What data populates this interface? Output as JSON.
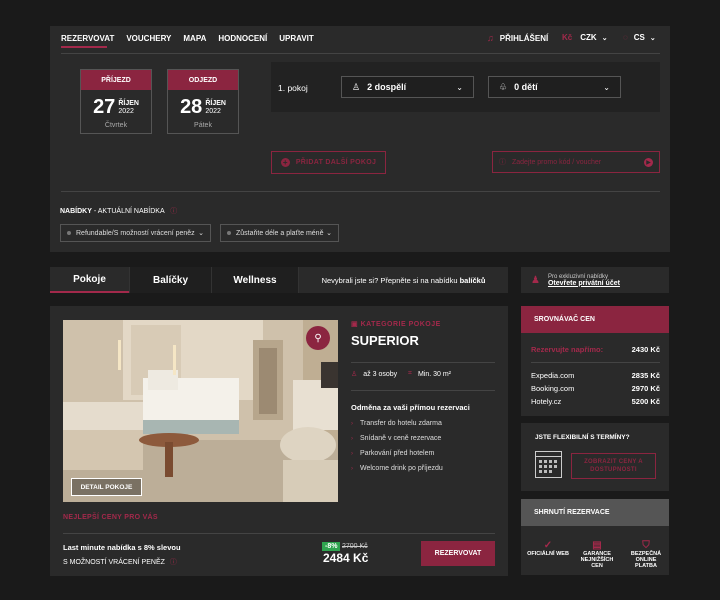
{
  "nav": {
    "items": [
      "REZERVOVAT",
      "VOUCHERY",
      "MAPA",
      "HODNOCENÍ",
      "UPRAVIT"
    ],
    "login": "PŘIHLÁŠENÍ",
    "currency_symbol": "Kč",
    "currency": "CZK",
    "language": "CS"
  },
  "booking": {
    "checkin": {
      "label": "PŘÍJEZD",
      "day": "27",
      "month": "ŘÍJEN",
      "year": "2022",
      "weekday": "Čtvrtek"
    },
    "checkout": {
      "label": "ODJEZD",
      "day": "28",
      "month": "ŘÍJEN",
      "year": "2022",
      "weekday": "Pátek"
    },
    "room_label": "1. pokoj",
    "adults": "2 dospělí",
    "children": "0 dětí",
    "add_room": "PŘIDAT DALŠÍ POKOJ",
    "promo_placeholder": "Zadejte promo kód / voucher"
  },
  "offers": {
    "title_bold": "NABÍDKY",
    "title_rest": " - AKTUÁLNÍ NABÍDKA",
    "filters": [
      "Refundable/S možností vrácení peněz",
      "Zůstaňte déle a plaťte méně"
    ]
  },
  "tabs": {
    "items": [
      "Pokoje",
      "Balíčky",
      "Wellness"
    ],
    "hint_prefix": "Nevybrali jste si? Přepněte si na nabídku ",
    "hint_link": "balíčků"
  },
  "private": {
    "line1": "Pro exkluzivní nabídky",
    "link": "Otevřete privátní účet"
  },
  "room": {
    "category": "KATEGORIE POKOJE",
    "name": "SUPERIOR",
    "persons": "až 3 osoby",
    "size": "Min. 30 m²",
    "reward_title": "Odměna za vaši přímou rezervaci",
    "rewards": [
      "Transfer do hotelu zdarma",
      "Snídaně v ceně rezervace",
      "Parkování před hotelem",
      "Welcome drink po příjezdu"
    ],
    "detail_button": "DETAIL POKOJE",
    "best_prices": "NEJLEPŠÍ CENY PRO VÁS"
  },
  "rate": {
    "title": "Last minute nabídka s 8% slevou",
    "subtitle": "S MOŽNOSTÍ VRÁCENÍ PENĚZ",
    "discount": "-8%",
    "old_price": "2700 Kč",
    "price": "2484 Kč",
    "book_button": "REZERVOVAT"
  },
  "compare": {
    "title": "SROVNÁVAČ CEN",
    "direct_label": "Rezervujte napřímo:",
    "direct_price": "2430 Kč",
    "rows": [
      {
        "name": "Expedia.com",
        "price": "2835 Kč"
      },
      {
        "name": "Booking.com",
        "price": "2970 Kč"
      },
      {
        "name": "Hotely.cz",
        "price": "5200 Kč"
      }
    ]
  },
  "flex": {
    "title": "JSTE FLEXIBILNÍ S TERMÍNY?",
    "button": "ZOBRAZIT CENY A DOSTUPNOSTI"
  },
  "summary": {
    "title": "SHRNUTÍ REZERVACE",
    "features": [
      "OFICIÁLNÍ WEB",
      "GARANCE NEJNIŽŠÍCH CEN",
      "BEZPEČNÁ ONLINE PLATBA"
    ]
  },
  "colors": {
    "accent": "#a3294b",
    "panel": "#2a2a2a",
    "bg": "#1a1a1a",
    "green": "#2fa44f"
  }
}
